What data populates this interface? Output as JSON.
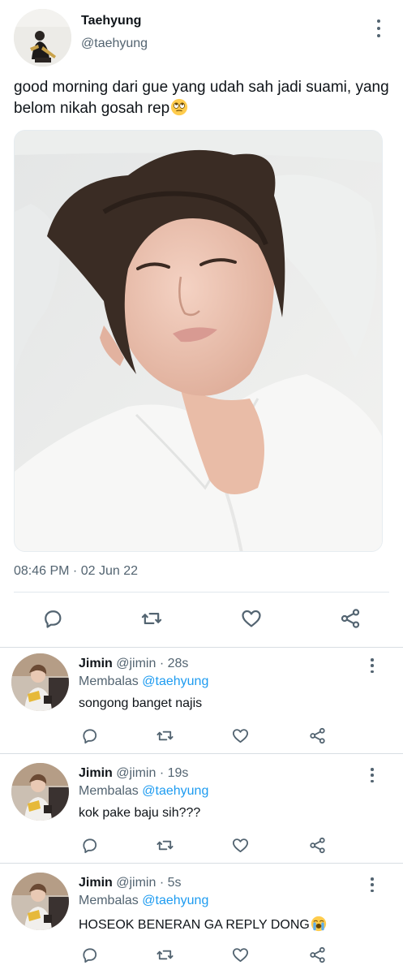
{
  "tweet": {
    "author_name": "Taehyung",
    "author_handle": "@taehyung",
    "text": "good morning dari gue yang udah sah jadi suami, yang belom nikah gosah rep",
    "text_emoji": "face-with-rolling-eyes",
    "timestamp": "08:46 PM · 02 Jun 22",
    "avatar_icon": "avatar-photo",
    "media_description_icon": "photo"
  },
  "actions": [
    "reply-icon",
    "retweet-icon",
    "like-icon",
    "share-icon"
  ],
  "replies": [
    {
      "name": "Jimin",
      "handle": "@jimin",
      "time": "· 28s",
      "replying_prefix": "Membalas",
      "replying_to": "@taehyung",
      "text": "songong banget najis",
      "emoji": ""
    },
    {
      "name": "Jimin",
      "handle": "@jimin",
      "time": "· 19s",
      "replying_prefix": "Membalas",
      "replying_to": "@taehyung",
      "text": "kok pake baju sih???",
      "emoji": ""
    },
    {
      "name": "Jimin",
      "handle": "@jimin",
      "time": "· 5s",
      "replying_prefix": "Membalas",
      "replying_to": "@taehyung",
      "text": "HOSEOK BENERAN GA REPLY DONG",
      "emoji": "loudly-crying-face"
    }
  ],
  "colors": {
    "text": "#0f1419",
    "secondary": "#536471",
    "link": "#1d9bf0",
    "divider": "#e1e8ed"
  }
}
